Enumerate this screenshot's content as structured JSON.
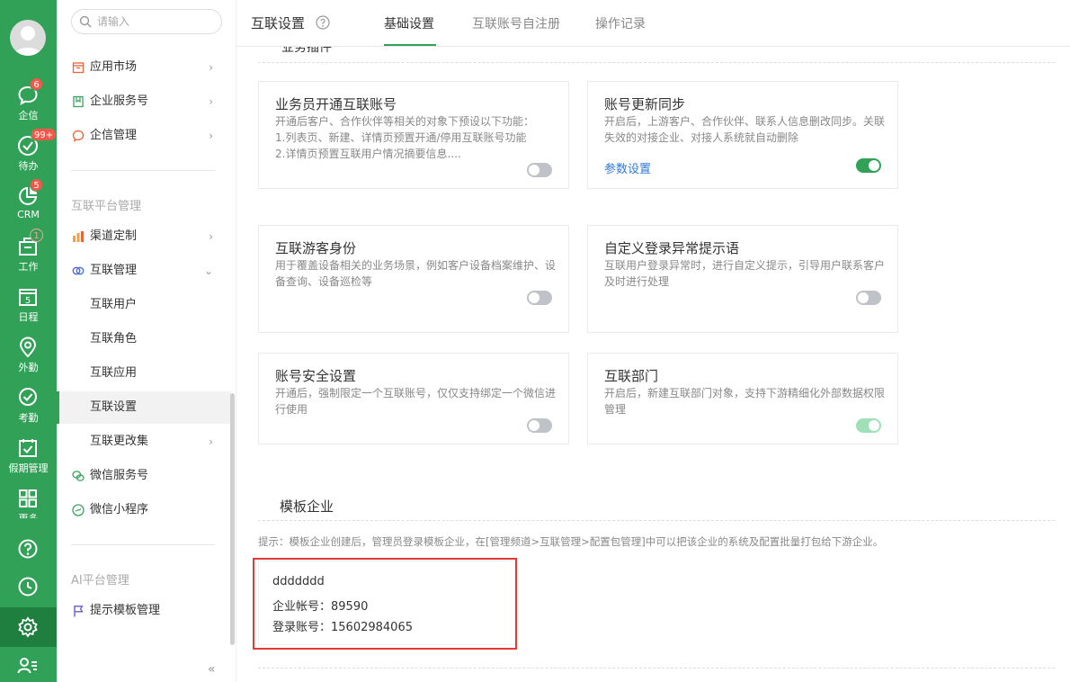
{
  "rail": {
    "items": [
      {
        "label": "企信",
        "badge": "6"
      },
      {
        "label": "待办",
        "badge": "99+"
      },
      {
        "label": "CRM",
        "badge": "5"
      },
      {
        "label": "工作",
        "badge": "1"
      },
      {
        "label": "日程"
      },
      {
        "label": "外勤"
      },
      {
        "label": "考勤"
      },
      {
        "label": "假期管理"
      },
      {
        "label": "更多"
      }
    ],
    "calendar_day": "5"
  },
  "sidebar": {
    "search_placeholder": "请输入",
    "top_items": [
      {
        "label": "应用市场"
      },
      {
        "label": "企业服务号"
      },
      {
        "label": "企信管理"
      }
    ],
    "group1_title": "互联平台管理",
    "group1_items": [
      {
        "label": "渠道定制"
      },
      {
        "label": "互联管理"
      },
      {
        "label": "互联用户"
      },
      {
        "label": "互联角色"
      },
      {
        "label": "互联应用"
      },
      {
        "label": "互联设置"
      },
      {
        "label": "互联更改集"
      },
      {
        "label": "微信服务号"
      },
      {
        "label": "微信小程序"
      }
    ],
    "group2_title": "AI平台管理",
    "group2_items": [
      {
        "label": "提示模板管理"
      }
    ],
    "collapse_symbol": "«"
  },
  "header": {
    "title": "互联设置",
    "tabs": [
      {
        "label": "基础设置"
      },
      {
        "label": "互联账号自注册"
      },
      {
        "label": "操作记录"
      }
    ]
  },
  "content": {
    "cut_section_title": "业务插件",
    "cards": [
      {
        "title": "业务员开通互联账号",
        "desc": "开通后客户、合作伙伴等相关的对象下预设以下功能：\n1.列表页、新建、详情页预置开通/停用互联账号功能\n2.详情页预置互联用户情况摘要信息....",
        "on": false
      },
      {
        "title": "账号更新同步",
        "desc": "开启后，上游客户、合作伙伴、联系人信息删改同步。关联失效的对接企业、对接人系统就自动删除",
        "link": "参数设置",
        "on": true
      },
      {
        "title": "互联游客身份",
        "desc": "用于覆盖设备相关的业务场景，例如客户设备档案维护、设备查询、设备巡检等",
        "on": false
      },
      {
        "title": "自定义登录异常提示语",
        "desc": "互联用户登录异常时，进行自定义提示，引导用户联系客户 及时进行处理",
        "on": false
      },
      {
        "title": "账号安全设置",
        "desc": "开通后，强制限定一个互联账号，仅仅支持绑定一个微信进行使用",
        "on": false
      },
      {
        "title": "互联部门",
        "desc": "开启后，新建互联部门对象，支持下游精细化外部数据权限管理",
        "on": true
      }
    ],
    "template_section_title": "模板企业",
    "hint": "提示：模板企业创建后，管理员登录模板企业，在[管理频道>互联管理>配置包管理]中可以把该企业的系统及配置批量打包给下游企业。",
    "template_company": {
      "name": "ddddddd",
      "enterprise_account_label": "企业帐号：",
      "enterprise_account": "89590",
      "login_account_label": "登录账号：",
      "login_account": "15602984065"
    }
  },
  "colors": {
    "brand_green": "#30a156",
    "badge_red": "#f6574a",
    "link_blue": "#2f7ad9",
    "highlight_red": "#e53935"
  }
}
